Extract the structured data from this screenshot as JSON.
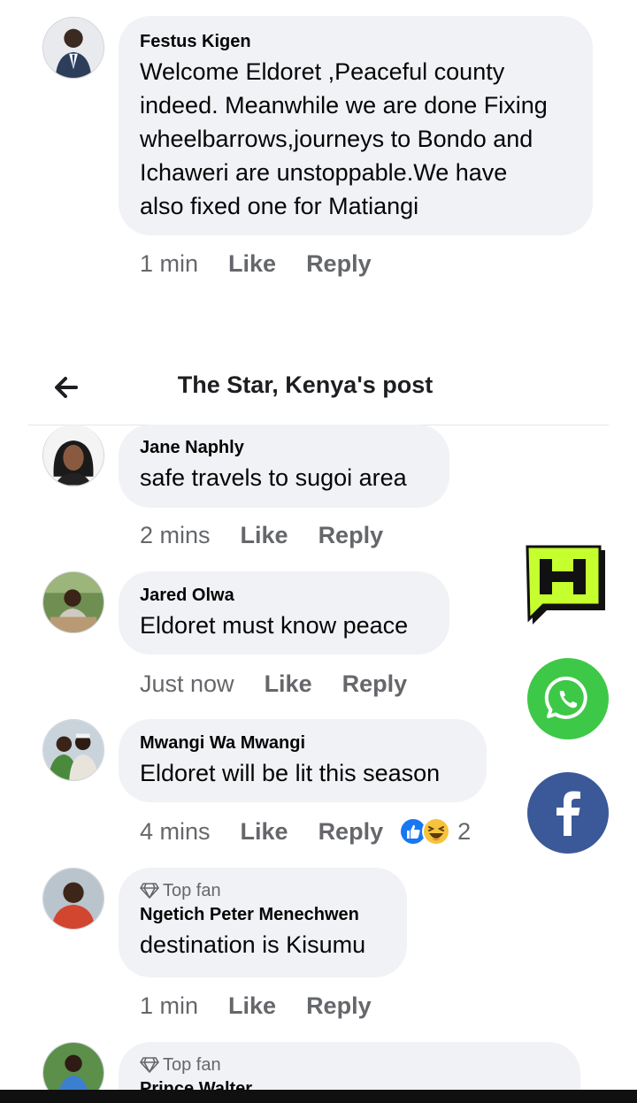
{
  "header": {
    "title": "The Star, Kenya's post"
  },
  "comments": [
    {
      "author": "Festus Kigen",
      "lines": [
        "Welcome Eldoret ,Peaceful county",
        "indeed. Meanwhile we are done Fixing",
        "wheelbarrows,journeys to Bondo and",
        "Ichaweri are unstoppable.We have",
        "also fixed one for Matiangi"
      ],
      "time": "1 min",
      "like": "Like",
      "reply": "Reply"
    },
    {
      "author": "Jane Naphly",
      "lines": [
        "safe travels to sugoi area"
      ],
      "time": "2 mins",
      "like": "Like",
      "reply": "Reply"
    },
    {
      "author": "Jared Olwa",
      "lines": [
        "Eldoret must know peace"
      ],
      "time": "Just now",
      "like": "Like",
      "reply": "Reply"
    },
    {
      "author": "Mwangi Wa Mwangi",
      "lines": [
        "Eldoret will be lit this season"
      ],
      "time": "4 mins",
      "like": "Like",
      "reply": "Reply",
      "reaction_count": "2"
    },
    {
      "badge": "Top fan",
      "author": "Ngetich Peter Menechwen",
      "lines": [
        "destination is Kisumu"
      ],
      "time": "1 min",
      "like": "Like",
      "reply": "Reply"
    },
    {
      "badge": "Top fan",
      "author": "Prince Walter"
    }
  ],
  "share_buttons": [
    "hiphop-logo-icon",
    "whatsapp-icon",
    "facebook-icon"
  ],
  "colors": {
    "bubble": "#f0f2f5",
    "meta_text": "#65676b",
    "whatsapp": "#3ec847",
    "facebook": "#3b5998",
    "brand_lime": "#c6ff2e",
    "like_blue": "#1877f2"
  }
}
